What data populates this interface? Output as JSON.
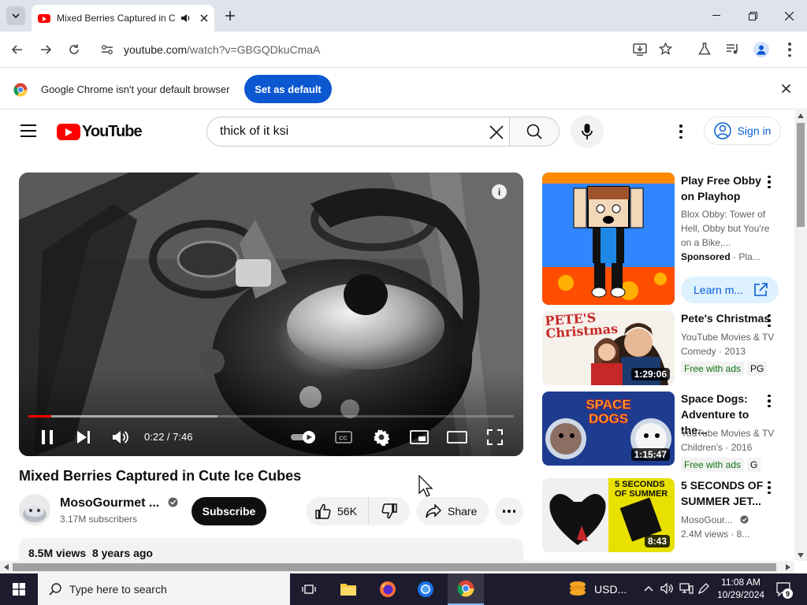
{
  "browser": {
    "tab_title": "Mixed Berries Captured in C",
    "url_host": "youtube.com",
    "url_path": "/watch?v=GBGQDkuCmaA",
    "infobar_message": "Google Chrome isn't your default browser",
    "set_default_label": "Set as default"
  },
  "youtube": {
    "logo_text": "YouTube",
    "search_value": "thick of it ksi",
    "sign_in_label": "Sign in"
  },
  "player": {
    "time_display": "0:22 / 7:46",
    "progress_fraction": 0.047,
    "buffered_fraction": 0.39
  },
  "video": {
    "title": "Mixed Berries Captured in Cute Ice Cubes",
    "channel_name": "MosoGourmet ...",
    "subscribers": "3.17M subscribers",
    "subscribe_label": "Subscribe",
    "likes": "56K",
    "share_label": "Share",
    "views": "8.5M views",
    "age": "8 years ago"
  },
  "sidebar": [
    {
      "title": "Play Free Obby on Playhop",
      "meta1": "Blox Obby: Tower of Hell, Obby but You're on a Bike,...",
      "sponsored": "Sponsored",
      "sponsor_suffix": " · Pla...",
      "cta": "Learn m..."
    },
    {
      "title": "Pete's Christmas",
      "meta1": "YouTube Movies & TV",
      "meta2": "Comedy · 2013",
      "free": "Free with ads",
      "rating": "PG",
      "duration": "1:29:06",
      "thumb_text": "PETE'S Christmas"
    },
    {
      "title": "Space Dogs: Adventure to the...",
      "meta1": "YouTube Movies & TV",
      "meta2": "Children's · 2016",
      "free": "Free with ads",
      "rating": "G",
      "duration": "1:15:47",
      "thumb_text": "SPACE DOGS"
    },
    {
      "title": "5 SECONDS OF SUMMER JET...",
      "meta1": "MosoGour...",
      "meta2": "2.4M views · 8...",
      "duration": "8:43",
      "thumb_text": "5 SECONDS OF SUMMER"
    }
  ],
  "taskbar": {
    "search_placeholder": "Type here to search",
    "weather": "USD...",
    "time": "11:08 AM",
    "date": "10/29/2024",
    "notifications": "9"
  }
}
